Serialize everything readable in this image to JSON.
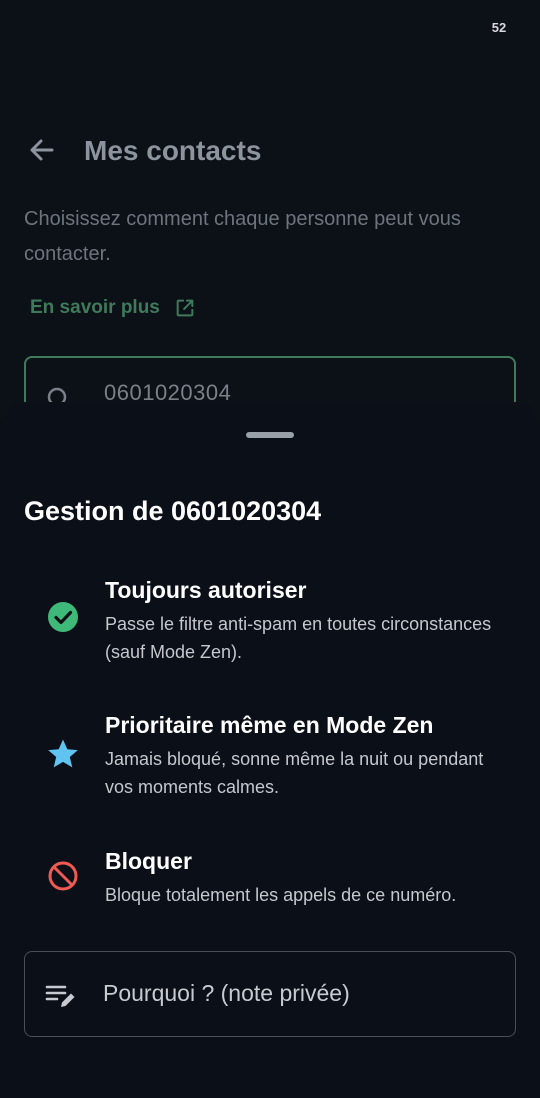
{
  "status_bar": {
    "badge": "52"
  },
  "header": {
    "title": "Mes contacts"
  },
  "intro": {
    "subtitle": "Choisissez comment chaque personne peut vous contacter.",
    "learn_more": "En savoir plus"
  },
  "search": {
    "value": "0601020304"
  },
  "sheet": {
    "title": "Gestion de 0601020304",
    "options": [
      {
        "icon": "check-circle-icon",
        "color": "#3fb97a",
        "title": "Toujours autoriser",
        "description": "Passe le filtre anti-spam en toutes circonstances (sauf Mode Zen)."
      },
      {
        "icon": "star-icon",
        "color": "#5fc4f0",
        "title": "Prioritaire même en Mode Zen",
        "description": "Jamais bloqué, sonne même la nuit ou pendant vos moments calmes."
      },
      {
        "icon": "block-icon",
        "color": "#ef5a52",
        "title": "Bloquer",
        "description": "Bloque totalement les appels de ce numéro."
      }
    ],
    "note_placeholder": "Pourquoi ? (note privée)"
  }
}
